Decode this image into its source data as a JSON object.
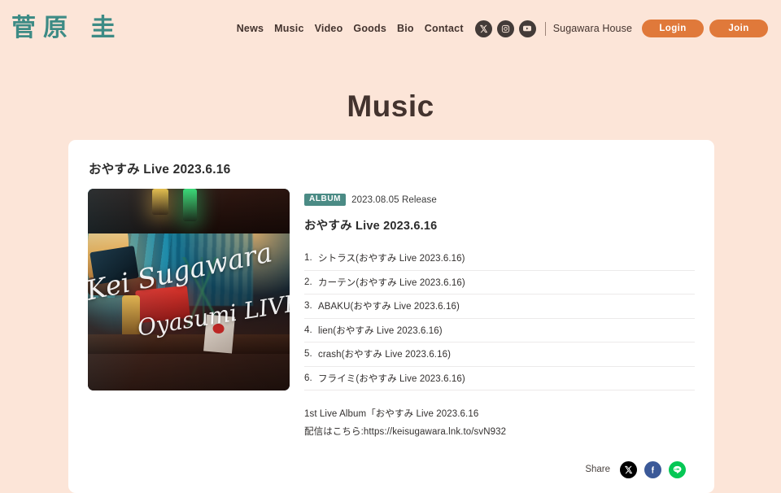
{
  "header": {
    "logo": "菅原 圭",
    "nav": [
      {
        "label": "News"
      },
      {
        "label": "Music"
      },
      {
        "label": "Video"
      },
      {
        "label": "Goods"
      },
      {
        "label": "Bio"
      },
      {
        "label": "Contact"
      }
    ],
    "socials": [
      {
        "name": "x-icon",
        "label": "X"
      },
      {
        "name": "instagram-icon",
        "label": "Instagram"
      },
      {
        "name": "youtube-icon",
        "label": "YouTube"
      }
    ],
    "house_link": "Sugawara House",
    "login_label": "Login",
    "join_label": "Join"
  },
  "page": {
    "title": "Music"
  },
  "release": {
    "card_title": "おやすみ Live 2023.6.16",
    "badge": "ALBUM",
    "release_date": "2023.08.05 Release",
    "title": "おやすみ Live 2023.6.16",
    "artwork_text_line1": "Kei Sugawara",
    "artwork_text_line2": "Oyasumi LIVE",
    "tracks": [
      {
        "num": "1.",
        "name": "シトラス(おやすみ Live 2023.6.16)"
      },
      {
        "num": "2.",
        "name": "カーテン(おやすみ Live 2023.6.16)"
      },
      {
        "num": "3.",
        "name": "ABAKU(おやすみ Live 2023.6.16)"
      },
      {
        "num": "4.",
        "name": "lien(おやすみ Live 2023.6.16)"
      },
      {
        "num": "5.",
        "name": "crash(おやすみ Live 2023.6.16)"
      },
      {
        "num": "6.",
        "name": "フライミ(おやすみ Live 2023.6.16)"
      }
    ],
    "desc_line1": "1st Live Album「おやすみ Live 2023.6.16",
    "desc_line2": "配信はこちら:https://keisugawara.lnk.to/svN932"
  },
  "share": {
    "label": "Share",
    "buttons": [
      {
        "name": "share-x-button"
      },
      {
        "name": "share-facebook-button"
      },
      {
        "name": "share-line-button"
      }
    ]
  },
  "colors": {
    "background": "#fce5d8",
    "brand_teal": "#3d8b85",
    "accent_orange": "#e0793a",
    "text_dark": "#43332e",
    "card_white": "#ffffff"
  }
}
